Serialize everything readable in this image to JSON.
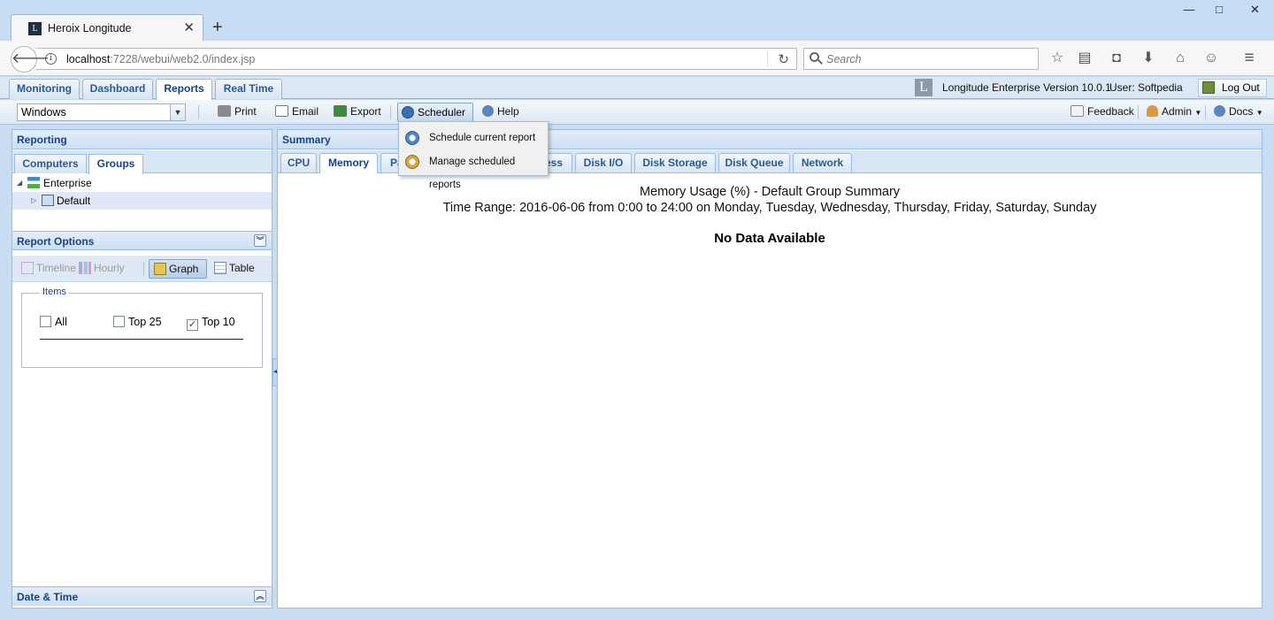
{
  "browser": {
    "tab_title": "Heroix Longitude",
    "url_host": "localhost",
    "url_rest": ":7228/webui/web2.0/index.jsp",
    "search_placeholder": "Search",
    "window_controls": [
      "—",
      "□",
      "✕"
    ]
  },
  "app": {
    "tabs": [
      {
        "label": "Monitoring"
      },
      {
        "label": "Dashboard"
      },
      {
        "label": "Reports"
      },
      {
        "label": "Real Time"
      }
    ],
    "active_tab": "Reports",
    "logo_letter": "L",
    "version": "Longitude Enterprise Version 10.0.1",
    "user": "User: Softpedia",
    "logout_label": "Log Out"
  },
  "toolbar": {
    "platform_value": "Windows",
    "print_label": "Print",
    "email_label": "Email",
    "export_label": "Export",
    "scheduler_label": "Scheduler",
    "help_label": "Help",
    "feedback_label": "Feedback",
    "admin_label": "Admin",
    "docs_label": "Docs"
  },
  "scheduler_menu": {
    "items": [
      {
        "label": "Schedule current report"
      },
      {
        "label": "Manage scheduled reports"
      }
    ]
  },
  "left_panel": {
    "title": "Reporting",
    "tabs": [
      {
        "label": "Computers"
      },
      {
        "label": "Groups"
      }
    ],
    "active_tab": "Groups",
    "tree": [
      {
        "label": "Enterprise",
        "expanded": true
      },
      {
        "label": "Default",
        "expanded": false,
        "selected": true
      }
    ],
    "report_options_title": "Report Options",
    "view_buttons": [
      {
        "label": "Timeline",
        "enabled": false
      },
      {
        "label": "Hourly",
        "enabled": false
      },
      {
        "label": "Graph",
        "pressed": true
      },
      {
        "label": "Table",
        "pressed": false
      }
    ],
    "items_legend": "Items",
    "items_options": [
      {
        "label": "All",
        "checked": false
      },
      {
        "label": "Top 25",
        "checked": false
      },
      {
        "label": "Top 10",
        "checked": true
      }
    ],
    "date_time_title": "Date & Time"
  },
  "right_panel": {
    "title": "Summary",
    "tabs": [
      {
        "label": "CPU"
      },
      {
        "label": "Memory"
      },
      {
        "label": "Pa"
      },
      {
        "label": "ess"
      },
      {
        "label": "Disk I/O"
      },
      {
        "label": "Disk Storage"
      },
      {
        "label": "Disk Queue"
      },
      {
        "label": "Network"
      }
    ],
    "active_tab": "Memory",
    "report_title": "Memory Usage (%) - Default Group Summary",
    "time_range": "Time Range: 2016-06-06 from 0:00 to 24:00 on Monday, Tuesday, Wednesday, Thursday, Friday, Saturday, Sunday",
    "no_data": "No Data Available"
  },
  "colors": {
    "header_text": "#15428b",
    "panel_border": "#99bbe8",
    "browser_frame": "#c7ddf5"
  }
}
